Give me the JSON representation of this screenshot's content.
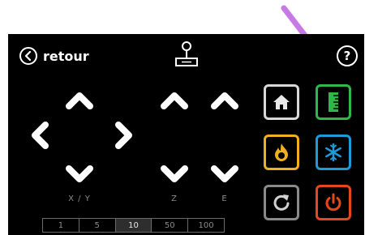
{
  "header": {
    "back_label": "retour",
    "help_label": "?"
  },
  "axes": {
    "xy_label": "X / Y",
    "z_label": "Z",
    "e_label": "E"
  },
  "steps": {
    "options": [
      "1",
      "5",
      "10",
      "50",
      "100"
    ],
    "selected": "10"
  },
  "tiles": [
    {
      "name": "home",
      "icon": "home-icon",
      "color": "#d8d8d8"
    },
    {
      "name": "level",
      "icon": "ruler-icon",
      "color": "#2fb84a"
    },
    {
      "name": "heat",
      "icon": "flame-icon",
      "color": "#f0b01e"
    },
    {
      "name": "cool",
      "icon": "snowflake-icon",
      "color": "#1f9ad8"
    },
    {
      "name": "reload",
      "icon": "refresh-icon",
      "color": "#8a8a8a"
    },
    {
      "name": "power",
      "icon": "power-icon",
      "color": "#e6461e"
    }
  ],
  "annotation": {
    "color": "#c77ae6"
  }
}
